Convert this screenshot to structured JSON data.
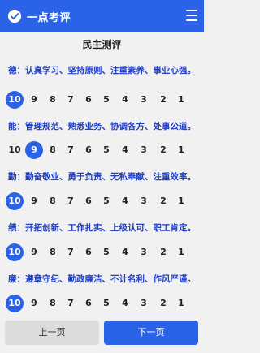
{
  "header": {
    "title": "一点考评",
    "logo_icon": "check-circle-icon",
    "menu_icon": "hamburger-menu-icon"
  },
  "page_title": "民主测评",
  "options": [
    "10",
    "9",
    "8",
    "7",
    "6",
    "5",
    "4",
    "3",
    "2",
    "1"
  ],
  "questions": [
    {
      "text": "德：认真学习、坚持原则、注重素养、事业心强。",
      "selected": "10"
    },
    {
      "text": "能：管理规范、熟悉业务、协调各方、处事公道。",
      "selected": "9"
    },
    {
      "text": "勤：勤奋敬业、勇于负责、无私奉献、注重效率。",
      "selected": "10"
    },
    {
      "text": "绩：开拓创新、工作扎实、上级认可、职工肯定。",
      "selected": "10"
    },
    {
      "text": "廉：遵章守纪、勤政廉洁、不计名利、作风严谨。",
      "selected": "10"
    }
  ],
  "footer": {
    "prev_label": "上一页",
    "next_label": "下一页"
  },
  "colors": {
    "accent": "#2a62e8",
    "question_text": "#1f3fc4"
  }
}
